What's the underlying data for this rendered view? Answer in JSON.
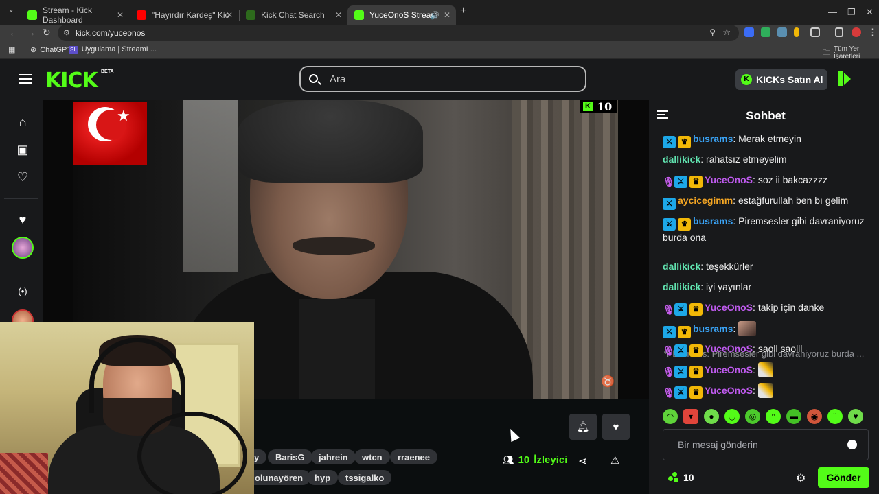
{
  "browser": {
    "tabs": [
      {
        "title": "Stream - Kick Dashboard",
        "favicon_color": "#53fc18"
      },
      {
        "title": "\"Hayırdır Kardeş\" Kick & Twitch",
        "favicon_color": "#ff0000"
      },
      {
        "title": "Kick Chat Search",
        "favicon_color": "#53fc18"
      },
      {
        "title": "YuceOnoS Stream - Watch l",
        "favicon_color": "#53fc18"
      }
    ],
    "new_tab": "+",
    "url": "kick.com/yuceonos",
    "bookmarks": [
      {
        "label": "ChatGPT"
      },
      {
        "label": "Uygulama | StreamL..."
      }
    ],
    "bookmarks_right": "Tüm Yer İşaretleri"
  },
  "header": {
    "logo": "KICK",
    "beta": "BETA",
    "search_placeholder": "Ara",
    "kicks_button": "KICKs Satın Al"
  },
  "video": {
    "overlay_count": "10"
  },
  "stream_info": {
    "tags_row1": [
      "y",
      "BarisG",
      "jahrein",
      "wtcn",
      "rraenee"
    ],
    "tags_row2": [
      "olunayören",
      "hyp",
      "tssigalko"
    ],
    "viewer_count": "10",
    "viewer_label": "İzleyici"
  },
  "chat": {
    "title": "Sohbet",
    "messages": [
      {
        "badges": [
          "mod",
          "vip"
        ],
        "user": "busrams",
        "color": "#3aa3f5",
        "text": "Merak etmeyin"
      },
      {
        "badges": [],
        "user": "dallikick",
        "color": "#62e6b2",
        "text": "rahatsız etmeyelim"
      },
      {
        "badges": [
          "mic",
          "mod",
          "vip"
        ],
        "user": "YuceOnoS",
        "color": "#c05bf0",
        "text": "soz ii bakcazzzz"
      },
      {
        "badges": [
          "mod"
        ],
        "user": "aycicegimm",
        "color": "#f5a623",
        "text": "estağfurullah ben bı gelim"
      },
      {
        "badges": [
          "mod",
          "vip"
        ],
        "user": "busrams",
        "color": "#3aa3f5",
        "text": "Piremsesler gibi davraniyoruz burda ona"
      },
      {
        "badges": [],
        "user": "dallikick",
        "color": "#62e6b2",
        "text": "teşekkürler"
      },
      {
        "badges": [],
        "user": "dallikick",
        "color": "#62e6b2",
        "text": "iyi yayınlar"
      },
      {
        "badges": [
          "mic",
          "mod",
          "vip"
        ],
        "user": "YuceOnoS",
        "color": "#c05bf0",
        "text": "takip için danke"
      },
      {
        "badges": [
          "mod",
          "vip"
        ],
        "user": "busrams",
        "color": "#3aa3f5",
        "text": ""
      },
      {
        "badges": [
          "mic",
          "mod",
          "vip"
        ],
        "user": "YuceOnoS",
        "color": "#c05bf0",
        "text": "saoll saolll"
      },
      {
        "badges": [
          "mic",
          "mod",
          "vip"
        ],
        "user": "YuceOnoS",
        "color": "#c05bf0",
        "text": ""
      },
      {
        "badges": [
          "mic",
          "mod",
          "vip"
        ],
        "user": "YuceOnoS",
        "color": "#c05bf0",
        "text": ""
      }
    ],
    "reply_preview": "busrams: Piremsesler gibi davraniyoruz burda ...",
    "input_placeholder": "Bir mesaj gönderin",
    "footer_count": "10",
    "send_label": "Gönder"
  },
  "colors": {
    "kick_green": "#53fc18",
    "bg_dark": "#0b0e0f",
    "panel": "#18191b"
  }
}
